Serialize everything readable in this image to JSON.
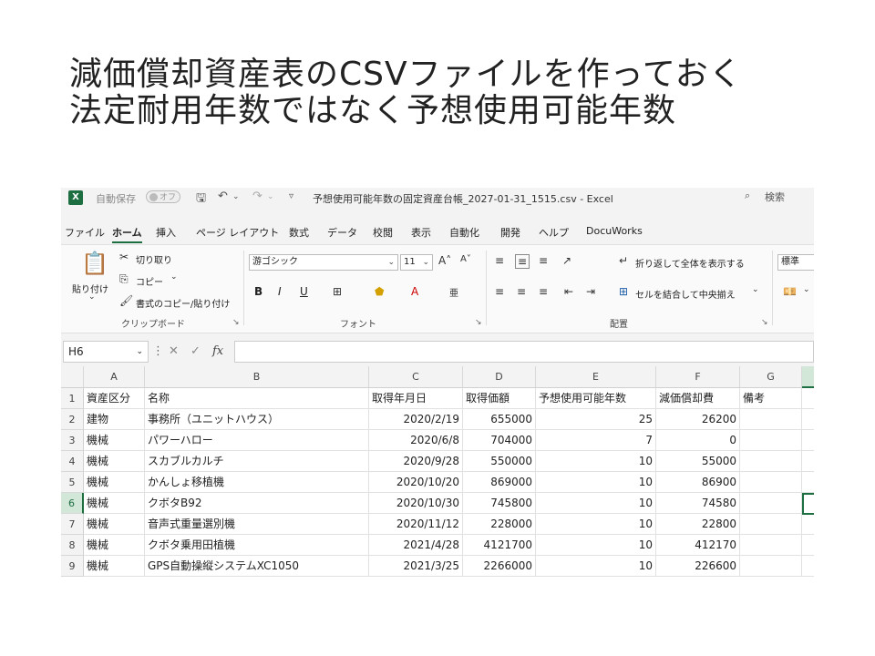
{
  "slide": {
    "title_line1": "減価償却資産表のCSVファイルを作っておく",
    "title_line2": "法定耐用年数ではなく予想使用可能年数"
  },
  "excel": {
    "autosave_label": "自動保存",
    "autosave_state": "オフ",
    "document_title": "予想使用可能年数の固定資産台帳_2027-01-31_1515.csv  -  Excel",
    "search_placeholder": "検索",
    "tabs": [
      "ファイル",
      "ホーム",
      "挿入",
      "ページ レイアウト",
      "数式",
      "データ",
      "校閲",
      "表示",
      "自動化",
      "開発",
      "ヘルプ",
      "DocuWorks"
    ],
    "active_tab": "ホーム",
    "ribbon": {
      "clipboard": {
        "paste": "貼り付け",
        "cut": "切り取り",
        "copy": "コピー",
        "format_painter": "書式のコピー/貼り付け",
        "label": "クリップボード"
      },
      "font": {
        "font_name": "游ゴシック",
        "font_size": "11",
        "bold": "B",
        "italic": "I",
        "underline": "U",
        "label": "フォント"
      },
      "alignment": {
        "wrap_text": "折り返して全体を表示する",
        "merge_center": "セルを結合して中央揃え",
        "label": "配置"
      },
      "number": {
        "format": "標準"
      }
    },
    "name_box": "H6",
    "fx_label": "fx",
    "column_headers": [
      "A",
      "B",
      "C",
      "D",
      "E",
      "F",
      "G"
    ],
    "row_numbers": [
      "1",
      "2",
      "3",
      "4",
      "5",
      "6",
      "7",
      "8",
      "9"
    ],
    "selected_cell": "H6",
    "rows": [
      [
        "資産区分",
        "名称",
        "取得年月日",
        "取得価額",
        "予想使用可能年数",
        "減価償却費",
        "備考"
      ],
      [
        "建物",
        "事務所（ユニットハウス）",
        "2020/2/19",
        "655000",
        "25",
        "26200",
        ""
      ],
      [
        "機械",
        "パワーハロー",
        "2020/6/8",
        "704000",
        "7",
        "0",
        ""
      ],
      [
        "機械",
        "スカブルカルチ",
        "2020/9/28",
        "550000",
        "10",
        "55000",
        ""
      ],
      [
        "機械",
        "かんしょ移植機",
        "2020/10/20",
        "869000",
        "10",
        "86900",
        ""
      ],
      [
        "機械",
        "クボタB92",
        "2020/10/30",
        "745800",
        "10",
        "74580",
        ""
      ],
      [
        "機械",
        "音声式重量選別機",
        "2020/11/12",
        "228000",
        "10",
        "22800",
        ""
      ],
      [
        "機械",
        "クボタ乗用田植機",
        "2021/4/28",
        "4121700",
        "10",
        "412170",
        ""
      ],
      [
        "機械",
        "GPS自動操縦システムXC1050",
        "2021/3/25",
        "2266000",
        "10",
        "226600",
        ""
      ]
    ]
  }
}
